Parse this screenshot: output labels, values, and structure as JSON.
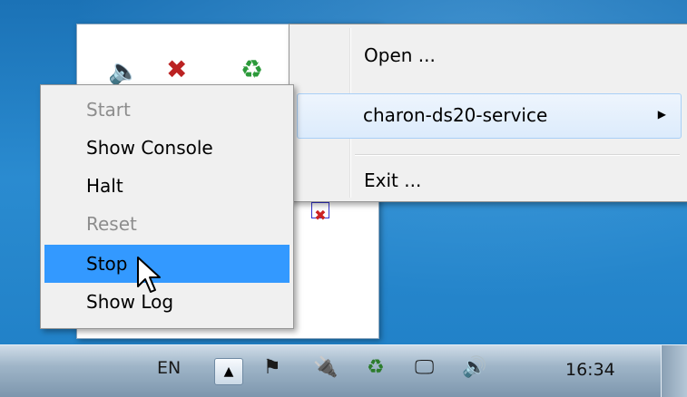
{
  "tray_panel": {
    "icons": [
      "speaker-icon",
      "tools-icon",
      "green-service-icon",
      "red-service-icon"
    ]
  },
  "main_menu": {
    "open": "Open ...",
    "service": "charon-ds20-service",
    "exit": "Exit ..."
  },
  "sub_menu": {
    "items": [
      {
        "label": "Start",
        "enabled": false
      },
      {
        "label": "Show Console",
        "enabled": true
      },
      {
        "label": "Halt",
        "enabled": true
      },
      {
        "label": "Reset",
        "enabled": false
      },
      {
        "label": "Stop",
        "enabled": true,
        "highlighted": true
      },
      {
        "label": "Show Log",
        "enabled": true
      }
    ]
  },
  "taskbar": {
    "language": "EN",
    "clock": "16:34",
    "icons": [
      "show-hidden-icons-icon",
      "action-center-flag-icon",
      "power-icon",
      "network-green-icon",
      "network-icon",
      "volume-icon"
    ]
  },
  "colors": {
    "menu_bg": "#f0f0f0",
    "highlight": "#3399ff",
    "disabled_text": "#8d8d8d"
  }
}
